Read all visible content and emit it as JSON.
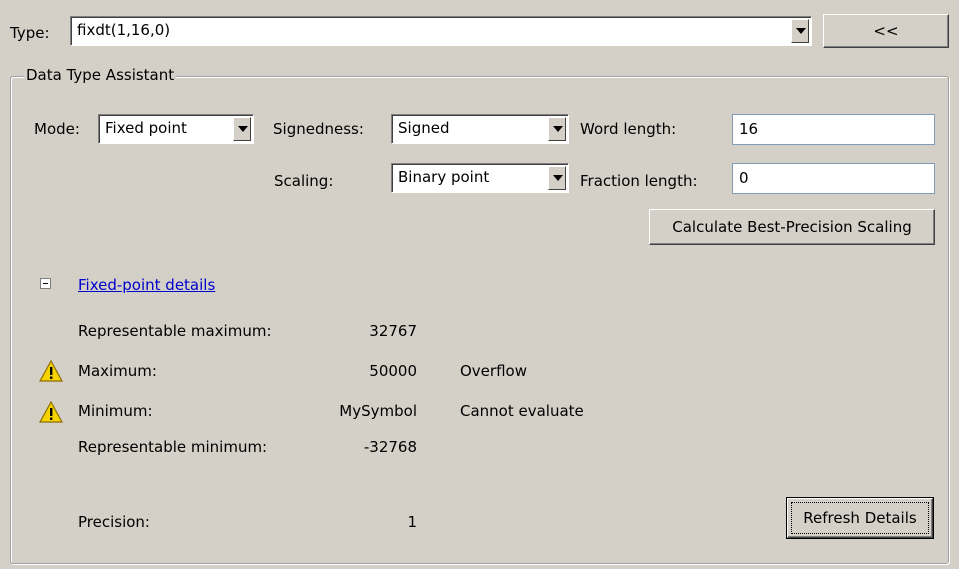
{
  "type_row": {
    "label": "Type:",
    "value": "fixdt(1,16,0)",
    "collapse_button": "<<"
  },
  "assistant": {
    "title": "Data Type Assistant",
    "mode_label": "Mode:",
    "mode_value": "Fixed point",
    "signedness_label": "Signedness:",
    "signedness_value": "Signed",
    "word_length_label": "Word length:",
    "word_length_value": "16",
    "scaling_label": "Scaling:",
    "scaling_value": "Binary point",
    "fraction_length_label": "Fraction length:",
    "fraction_length_value": "0",
    "calc_button": "Calculate Best-Precision Scaling"
  },
  "details": {
    "toggle_state": "expanded",
    "link": "Fixed-point details",
    "rows": [
      {
        "label": "Representable maximum:",
        "value": "32767",
        "note": "",
        "warning": false
      },
      {
        "label": "Maximum:",
        "value": "50000",
        "note": "Overflow",
        "warning": true
      },
      {
        "label": "Minimum:",
        "value": "MySymbol",
        "note": "Cannot evaluate",
        "warning": true
      },
      {
        "label": "Representable minimum:",
        "value": "-32768",
        "note": "",
        "warning": false
      }
    ],
    "precision_label": "Precision:",
    "precision_value": "1",
    "refresh_button": "Refresh Details"
  },
  "colors": {
    "background": "#d4d0c8",
    "link": "#0000cc",
    "warning": "#f5d200"
  },
  "icons": {
    "warning": "warning-triangle-icon",
    "toggle": "collapse-minus-icon",
    "dropdown": "chevron-down-icon"
  }
}
